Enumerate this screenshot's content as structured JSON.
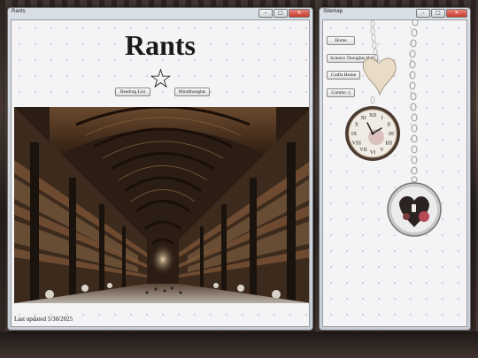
{
  "rants_window": {
    "title": "Rants",
    "controls": {
      "minimize": "–",
      "maximize": "□",
      "close": "✕"
    },
    "heading": "Rants",
    "nav": {
      "reading_list": "Reading List",
      "mindthoughts": "Mindthoughts"
    },
    "star_glyph": "☆",
    "last_updated": "Last updated 5/30/2025"
  },
  "sitemap_window": {
    "title": "Sitemap",
    "controls": {
      "minimize": "–",
      "maximize": "□",
      "close": "✕"
    },
    "links": [
      "Home",
      "Science Thoughts Hub",
      "Crafts Home",
      "Gumbo :)"
    ]
  },
  "clock": {
    "numerals": [
      "XII",
      "I",
      "II",
      "III",
      "IIII",
      "V",
      "VI",
      "VII",
      "VIII",
      "IX",
      "X",
      "XI"
    ]
  },
  "colors": {
    "accent_close": "#c8392b",
    "titlebar": "#d9dee6",
    "client_bg": "#f4f4f6"
  }
}
